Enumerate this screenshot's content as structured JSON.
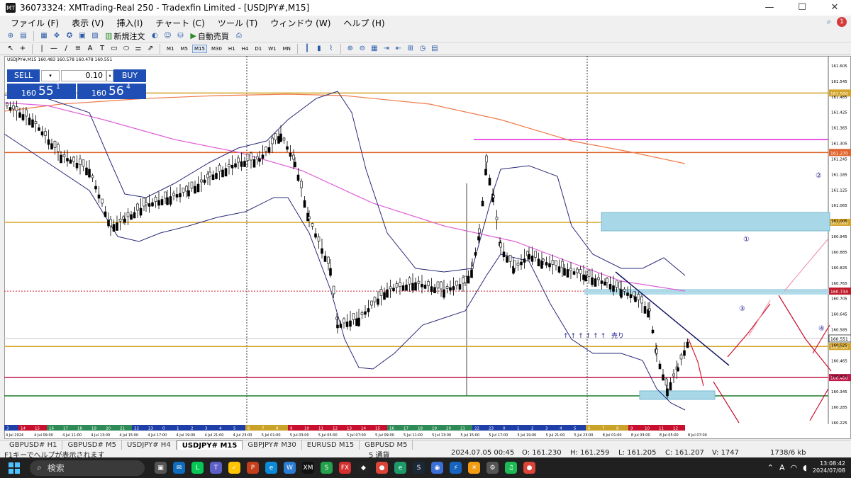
{
  "window": {
    "title": "36073324: XMTrading-Real 250 - Tradexfin Limited - [USDJPY#,M15]",
    "app_icon": "mt4-icon",
    "controls": [
      "—",
      "☐",
      "✕"
    ]
  },
  "menu": {
    "items": [
      "ファイル (F)",
      "表示 (V)",
      "挿入(I)",
      "チャート (C)",
      "ツール (T)",
      "ウィンドウ (W)",
      "ヘルプ (H)"
    ],
    "notification_count": "1"
  },
  "toolbar": {
    "new_order": "新規注文",
    "auto_trade": "自動売買",
    "timeframes": [
      "M1",
      "M5",
      "M15",
      "M30",
      "H1",
      "H4",
      "D1",
      "W1",
      "MN"
    ],
    "active_timeframe": "M15"
  },
  "chart": {
    "header": "USDJPY#,M15 160.483 160.578 160.478 160.551",
    "trade_panel": {
      "sell_label": "SELL",
      "buy_label": "BUY",
      "lot": "0.10",
      "sell_price_prefix": "160",
      "sell_price_big": "55",
      "sell_price_sup": "1",
      "buy_price_prefix": "160",
      "buy_price_big": "56",
      "buy_price_sup": "4"
    },
    "annotation_sell": "売り",
    "annotation_arrows": "↑↑↑↑↑↑",
    "circle_labels": [
      "①",
      "②",
      "③",
      "④"
    ],
    "price_axis": [
      "161.605",
      "161.545",
      "161.485",
      "161.425",
      "161.365",
      "161.305",
      "161.245",
      "161.185",
      "161.125",
      "161.065",
      "161.005",
      "160.945",
      "160.885",
      "160.825",
      "160.765",
      "160.705",
      "160.645",
      "160.585",
      "160.525",
      "160.465",
      "160.405",
      "160.345",
      "160.285",
      "160.225"
    ],
    "price_tags": {
      "gold_top": "161.500",
      "orange": "161.270",
      "gold_mid": "161.000",
      "red_dotted": "160.734",
      "current": "160.551",
      "gold_low": "160.520",
      "crimson": "160.400"
    },
    "time_labels": [
      "4 Jul 2024",
      "4 Jul 09:00",
      "4 Jul 11:00",
      "4 Jul 13:00",
      "4 Jul 15:00",
      "4 Jul 17:00",
      "4 Jul 19:00",
      "4 Jul 21:00",
      "4 Jul 23:00",
      "5 Jul 01:00",
      "5 Jul 03:00",
      "5 Jul 05:00",
      "5 Jul 07:00",
      "5 Jul 09:00",
      "5 Jul 11:00",
      "5 Jul 13:00",
      "5 Jul 15:00",
      "5 Jul 17:00",
      "5 Jul 19:00",
      "5 Jul 21:00",
      "5 Jul 23:00",
      "8 Jul 01:00",
      "8 Jul 03:00",
      "8 Jul 05:00",
      "8 Jul 07:00"
    ],
    "session_hours": [
      "3",
      "14",
      "15",
      "16",
      "17",
      "18",
      "19",
      "20",
      "21",
      "22",
      "23",
      "0",
      "1",
      "2",
      "3",
      "4",
      "5",
      "6",
      "7",
      "8",
      "9",
      "10",
      "11",
      "12",
      "13",
      "14",
      "15",
      "16",
      "17",
      "18",
      "19",
      "20",
      "21",
      "22",
      "23",
      "0",
      "1",
      "2",
      "3",
      "4",
      "5",
      "6",
      "7",
      "8",
      "9",
      "10",
      "11",
      "12"
    ]
  },
  "chart_tabs": [
    "GBPUSD# H1",
    "GBPUSD# M5",
    "USDJPY# H4",
    "USDJPY# M15",
    "GBPJPY# M30",
    "EURUSD M15",
    "GBPUSD M5"
  ],
  "active_chart_tab": "USDJPY# M15",
  "status": {
    "help": "F1キーでヘルプが表示されます",
    "profile": "5 通貨",
    "datetime": "2024.07.05 00:45",
    "open": "O: 161.230",
    "high": "H: 161.259",
    "low": "L: 161.205",
    "close": "C: 161.207",
    "volume": "V: 1747",
    "traffic": "1738/6 kb"
  },
  "taskbar": {
    "search_placeholder": "検索",
    "time": "13:08:42",
    "date": "2024/07/08",
    "apps": [
      {
        "name": "task-view-icon",
        "color": "#555555",
        "glyph": "▣"
      },
      {
        "name": "mail-icon",
        "color": "#0f6cbd",
        "glyph": "✉"
      },
      {
        "name": "line-icon",
        "color": "#06c755",
        "glyph": "L"
      },
      {
        "name": "teams-icon",
        "color": "#5b5fc7",
        "glyph": "T"
      },
      {
        "name": "norton-icon",
        "color": "#ffc400",
        "glyph": "✓"
      },
      {
        "name": "powerpoint-icon",
        "color": "#c43e1c",
        "glyph": "P"
      },
      {
        "name": "edge-icon",
        "color": "#0c8ad8",
        "glyph": "e"
      },
      {
        "name": "word-icon",
        "color": "#2b7cd3",
        "glyph": "W"
      },
      {
        "name": "xm-icon",
        "color": "#111111",
        "glyph": "XM"
      },
      {
        "name": "s-app-icon",
        "color": "#22a04b",
        "glyph": "S"
      },
      {
        "name": "fx-app-icon",
        "color": "#d32f2f",
        "glyph": "FX"
      },
      {
        "name": "capcut-icon",
        "color": "#222222",
        "glyph": "◆"
      },
      {
        "name": "chrome-icon",
        "color": "#db4437",
        "glyph": "●"
      },
      {
        "name": "edge2-icon",
        "color": "#1c9a6a",
        "glyph": "e"
      },
      {
        "name": "steam-icon",
        "color": "#1b2838",
        "glyph": "S"
      },
      {
        "name": "globe-icon",
        "color": "#3a6fd8",
        "glyph": "◉"
      },
      {
        "name": "vpn-icon",
        "color": "#1565c0",
        "glyph": "⚡"
      },
      {
        "name": "weather-icon",
        "color": "#f39c12",
        "glyph": "☀"
      },
      {
        "name": "settings-icon",
        "color": "#555555",
        "glyph": "⚙"
      },
      {
        "name": "spotify-icon",
        "color": "#1db954",
        "glyph": "♫"
      },
      {
        "name": "chrome2-icon",
        "color": "#db4437",
        "glyph": "●"
      }
    ]
  }
}
